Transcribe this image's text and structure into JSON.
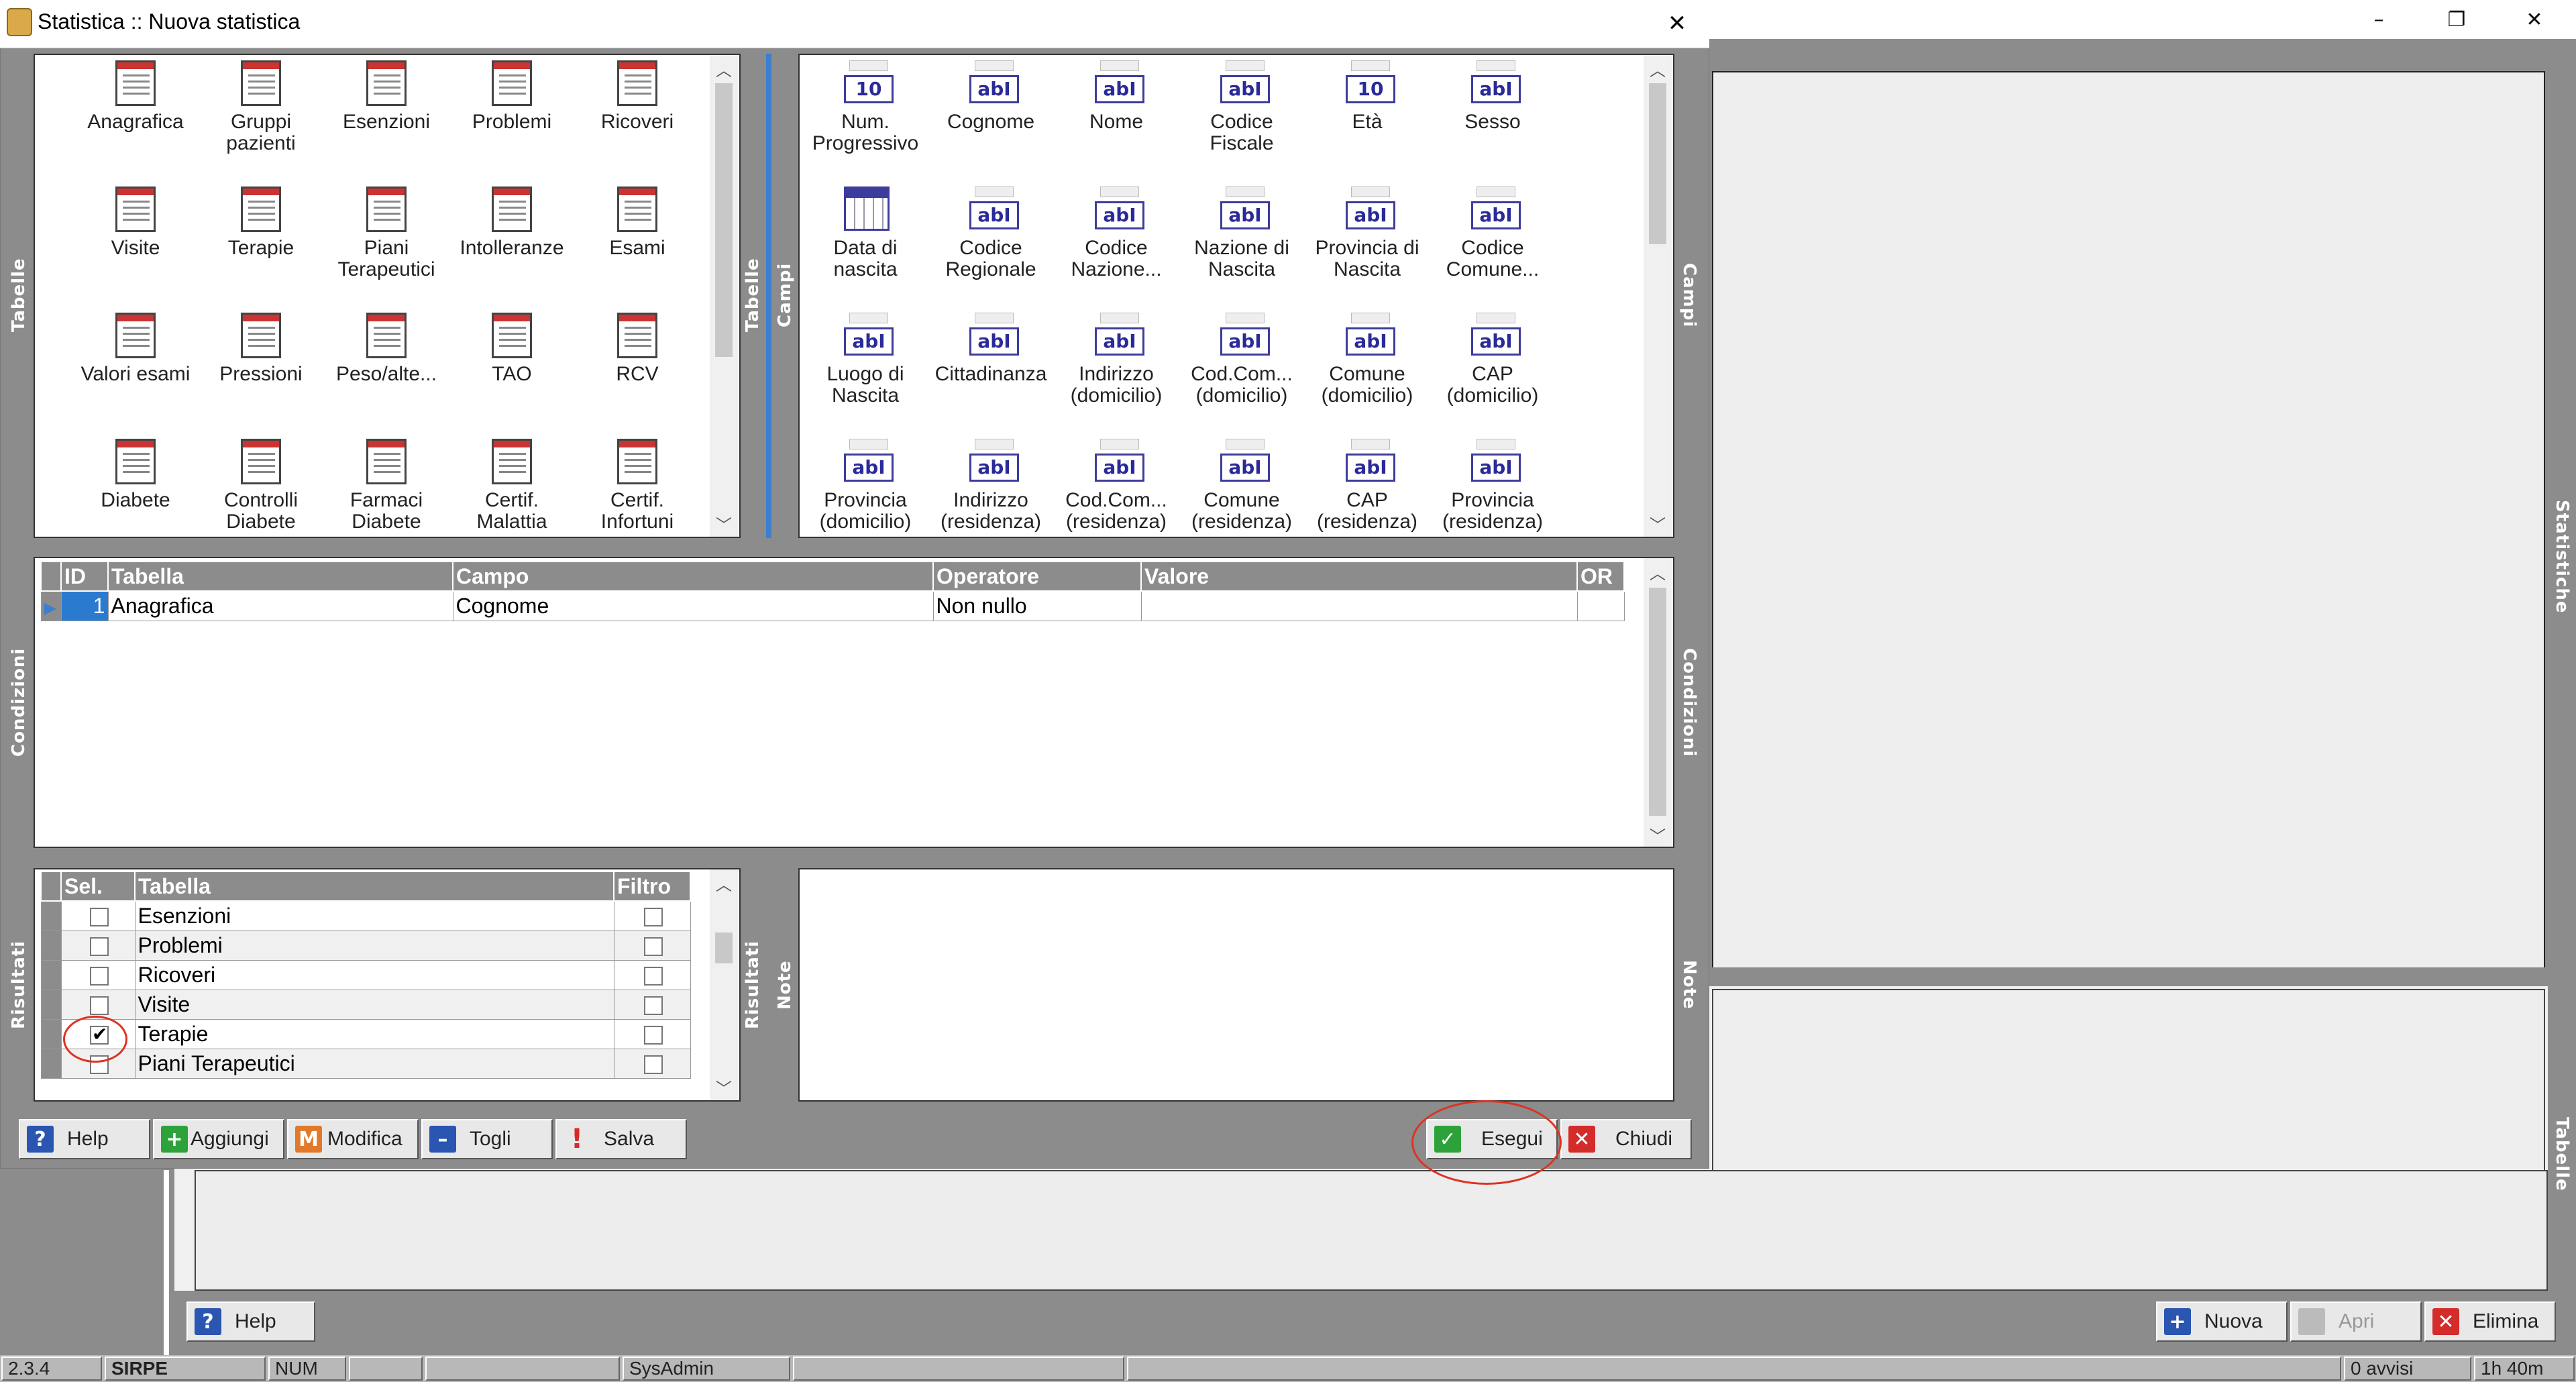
{
  "dialog": {
    "title": "Statistica :: Nuova statistica",
    "close_symbol": "✕"
  },
  "window_controls": {
    "minimize": "–",
    "restore": "❐",
    "close": "✕"
  },
  "tables_panel": {
    "label": "Tabelle",
    "items": [
      "Anagrafica",
      "Gruppi pazienti",
      "Esenzioni",
      "Problemi",
      "Ricoveri",
      "Visite",
      "Terapie",
      "Piani Terapeutici",
      "Intolleranze",
      "Esami",
      "Valori esami",
      "Pressioni",
      "Peso/alte...",
      "TAO",
      "RCV",
      "Diabete",
      "Controlli Diabete",
      "Farmaci Diabete",
      "Certif. Malattia",
      "Certif. Infortuni"
    ]
  },
  "fields_panel": {
    "label_left": "Tabelle",
    "label_left2": "Campi",
    "label_right": "Campi",
    "items": [
      {
        "label": "Num. Progressivo",
        "icon": "numeric-field-icon",
        "glyph": "10"
      },
      {
        "label": "Cognome",
        "icon": "text-field-icon",
        "glyph": "abI"
      },
      {
        "label": "Nome",
        "icon": "text-field-icon",
        "glyph": "abI"
      },
      {
        "label": "Codice Fiscale",
        "icon": "text-field-icon",
        "glyph": "abI"
      },
      {
        "label": "Età",
        "icon": "numeric-field-icon",
        "glyph": "10"
      },
      {
        "label": "Sesso",
        "icon": "text-field-icon",
        "glyph": "abI"
      },
      {
        "label": "Data di nascita",
        "icon": "date-field-icon",
        "glyph": ""
      },
      {
        "label": "Codice Regionale",
        "icon": "text-field-icon",
        "glyph": "abI"
      },
      {
        "label": "Codice Nazione...",
        "icon": "text-field-icon",
        "glyph": "abI"
      },
      {
        "label": "Nazione di Nascita",
        "icon": "text-field-icon",
        "glyph": "abI"
      },
      {
        "label": "Provincia di Nascita",
        "icon": "text-field-icon",
        "glyph": "abI"
      },
      {
        "label": "Codice Comune...",
        "icon": "text-field-icon",
        "glyph": "abI"
      },
      {
        "label": "Luogo di Nascita",
        "icon": "text-field-icon",
        "glyph": "abI"
      },
      {
        "label": "Cittadinanza",
        "icon": "text-field-icon",
        "glyph": "abI"
      },
      {
        "label": "Indirizzo (domicilio)",
        "icon": "text-field-icon",
        "glyph": "abI"
      },
      {
        "label": "Cod.Com... (domicilio)",
        "icon": "text-field-icon",
        "glyph": "abI"
      },
      {
        "label": "Comune (domicilio)",
        "icon": "text-field-icon",
        "glyph": "abI"
      },
      {
        "label": "CAP (domicilio)",
        "icon": "text-field-icon",
        "glyph": "abI"
      },
      {
        "label": "Provincia (domicilio)",
        "icon": "text-field-icon",
        "glyph": "abI"
      },
      {
        "label": "Indirizzo (residenza)",
        "icon": "text-field-icon",
        "glyph": "abI"
      },
      {
        "label": "Cod.Com... (residenza)",
        "icon": "text-field-icon",
        "glyph": "abI"
      },
      {
        "label": "Comune (residenza)",
        "icon": "text-field-icon",
        "glyph": "abI"
      },
      {
        "label": "CAP (residenza)",
        "icon": "text-field-icon",
        "glyph": "abI"
      },
      {
        "label": "Provincia (residenza)",
        "icon": "text-field-icon",
        "glyph": "abI"
      }
    ]
  },
  "conditions": {
    "label": "Condizioni",
    "columns": [
      "ID",
      "Tabella",
      "Campo",
      "Operatore",
      "Valore",
      "OR"
    ],
    "rows": [
      {
        "id": "1",
        "tabella": "Anagrafica",
        "campo": "Cognome",
        "operatore": "Non nullo",
        "valore": "",
        "or": ""
      }
    ]
  },
  "results": {
    "label": "Risultati",
    "columns": [
      "Sel.",
      "Tabella",
      "Filtro"
    ],
    "rows": [
      {
        "sel": false,
        "tabella": "Esenzioni",
        "filtro": false
      },
      {
        "sel": false,
        "tabella": "Problemi",
        "filtro": false
      },
      {
        "sel": false,
        "tabella": "Ricoveri",
        "filtro": false
      },
      {
        "sel": false,
        "tabella": "Visite",
        "filtro": false
      },
      {
        "sel": true,
        "tabella": "Terapie",
        "filtro": false
      },
      {
        "sel": false,
        "tabella": "Piani Terapeutici",
        "filtro": false
      }
    ]
  },
  "notes": {
    "label_left": "Risultati",
    "label_left2": "Note",
    "label_right": "Note",
    "text": ""
  },
  "toolbar": {
    "help": "Help",
    "aggiungi": "Aggiungi",
    "modifica": "Modifica",
    "togli": "Togli",
    "salva": "Salva",
    "esegui": "Esegui",
    "chiudi": "Chiudi"
  },
  "background": {
    "statistiche_label": "Statistiche",
    "tabelle_label": "Tabelle",
    "help": "Help",
    "nuova": "Nuova",
    "apri": "Apri",
    "elimina": "Elimina"
  },
  "statusbar": {
    "version": "2.3.4",
    "app": "SIRPE",
    "num": "NUM",
    "user": "SysAdmin",
    "avvisi": "0 avvisi",
    "time": "1h 40m"
  }
}
